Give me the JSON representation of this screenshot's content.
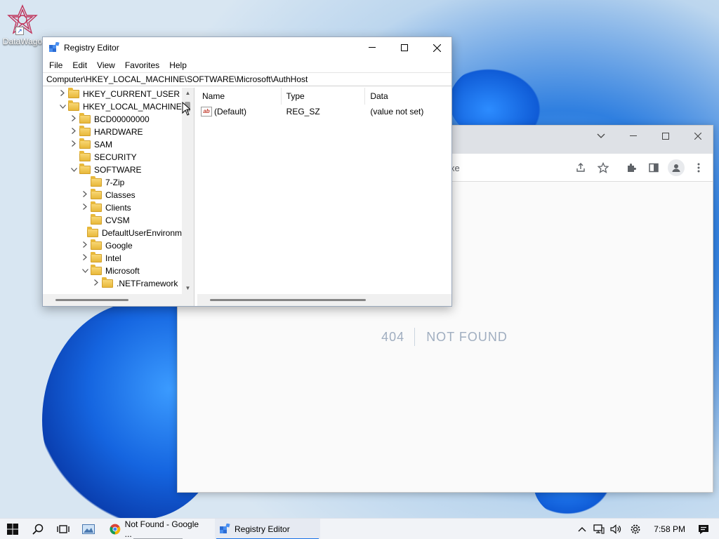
{
  "desktop": {
    "icon_label": "DataWago"
  },
  "registry_editor": {
    "title": "Registry Editor",
    "menu": [
      "File",
      "Edit",
      "View",
      "Favorites",
      "Help"
    ],
    "address": "Computer\\HKEY_LOCAL_MACHINE\\SOFTWARE\\Microsoft\\AuthHost",
    "tree": [
      {
        "label": "HKEY_CURRENT_USER",
        "level": 1,
        "arrow": "›"
      },
      {
        "label": "HKEY_LOCAL_MACHINE",
        "level": 1,
        "arrow": "⌄"
      },
      {
        "label": "BCD00000000",
        "level": 2,
        "arrow": "›"
      },
      {
        "label": "HARDWARE",
        "level": 2,
        "arrow": "›"
      },
      {
        "label": "SAM",
        "level": 2,
        "arrow": "›"
      },
      {
        "label": "SECURITY",
        "level": 2,
        "arrow": ""
      },
      {
        "label": "SOFTWARE",
        "level": 2,
        "arrow": "⌄"
      },
      {
        "label": "7-Zip",
        "level": 3,
        "arrow": ""
      },
      {
        "label": "Classes",
        "level": 3,
        "arrow": "›"
      },
      {
        "label": "Clients",
        "level": 3,
        "arrow": "›"
      },
      {
        "label": "CVSM",
        "level": 3,
        "arrow": ""
      },
      {
        "label": "DefaultUserEnvironm",
        "level": 3,
        "arrow": ""
      },
      {
        "label": "Google",
        "level": 3,
        "arrow": "›"
      },
      {
        "label": "Intel",
        "level": 3,
        "arrow": "›"
      },
      {
        "label": "Microsoft",
        "level": 3,
        "arrow": "⌄"
      },
      {
        "label": ".NETFramework",
        "level": 4,
        "arrow": "›"
      }
    ],
    "columns": {
      "name": "Name",
      "type": "Type",
      "data": "Data"
    },
    "values": [
      {
        "name": "(Default)",
        "type": "REG_SZ",
        "data": "(value not set)"
      }
    ]
  },
  "browser": {
    "url_fragment": "xe",
    "page": {
      "code": "404",
      "message": "NOT FOUND"
    }
  },
  "taskbar": {
    "tasks": [
      {
        "label": "Not Found - Google ...",
        "active": false
      },
      {
        "label": "Registry Editor",
        "active": true
      }
    ],
    "clock": "7:58 PM"
  }
}
